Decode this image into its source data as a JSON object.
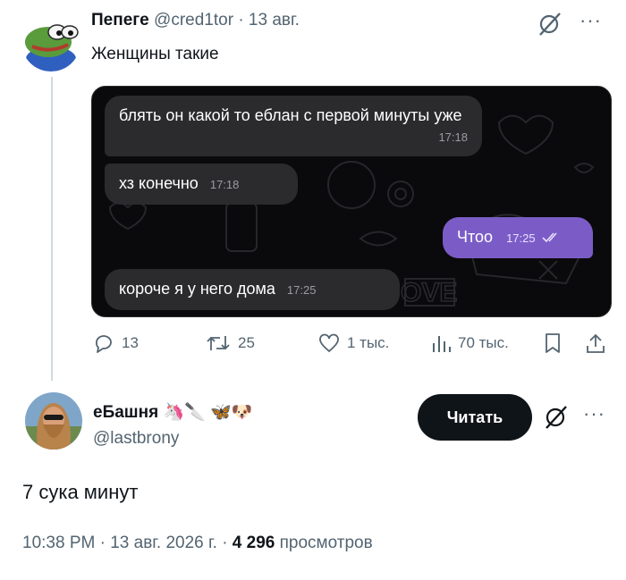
{
  "tweet1": {
    "display_name": "Пепеге",
    "handle": "@cred1tor",
    "separator": "·",
    "date": "13 авг.",
    "text": "Женщины такие",
    "more_label": "···",
    "chat": {
      "messages": [
        {
          "text": "блять он какой то еблан с первой минуты уже",
          "time": "17:18",
          "direction": "incoming"
        },
        {
          "text": "хз конечно",
          "time": "17:18",
          "direction": "incoming"
        },
        {
          "text": "Чтоо",
          "time": "17:25",
          "direction": "outgoing"
        },
        {
          "text": "короче я у него дома",
          "time": "17:25",
          "direction": "incoming"
        }
      ],
      "bubble_color": "#2b2b2e",
      "outgoing_color": "#7b5cc7",
      "background_color": "#0a0a0c"
    },
    "actions": {
      "replies": "13",
      "retweets": "25",
      "likes": "1 тыс.",
      "views": "70 тыс."
    }
  },
  "tweet2": {
    "display_name": "еБашня",
    "name_emojis": "🦄🔪 🦋🐶",
    "handle": "@lastbrony",
    "follow_label": "Читать",
    "more_label": "···",
    "text": "7 сука минут",
    "time": "10:38 PM",
    "date": "13 авг. 2026 г.",
    "separator": "·",
    "views_count": "4 296",
    "views_label": "просмотров"
  },
  "icons": [
    "pepe-avatar",
    "grok-icon",
    "more-icon",
    "reply-icon",
    "retweet-icon",
    "like-icon",
    "views-icon",
    "bookmark-icon",
    "share-icon",
    "read-check-icon"
  ],
  "colors": {
    "text": "#0f1419",
    "secondary": "#536471",
    "thread_line": "#cfd9de",
    "follow_button": "#0f1419"
  }
}
